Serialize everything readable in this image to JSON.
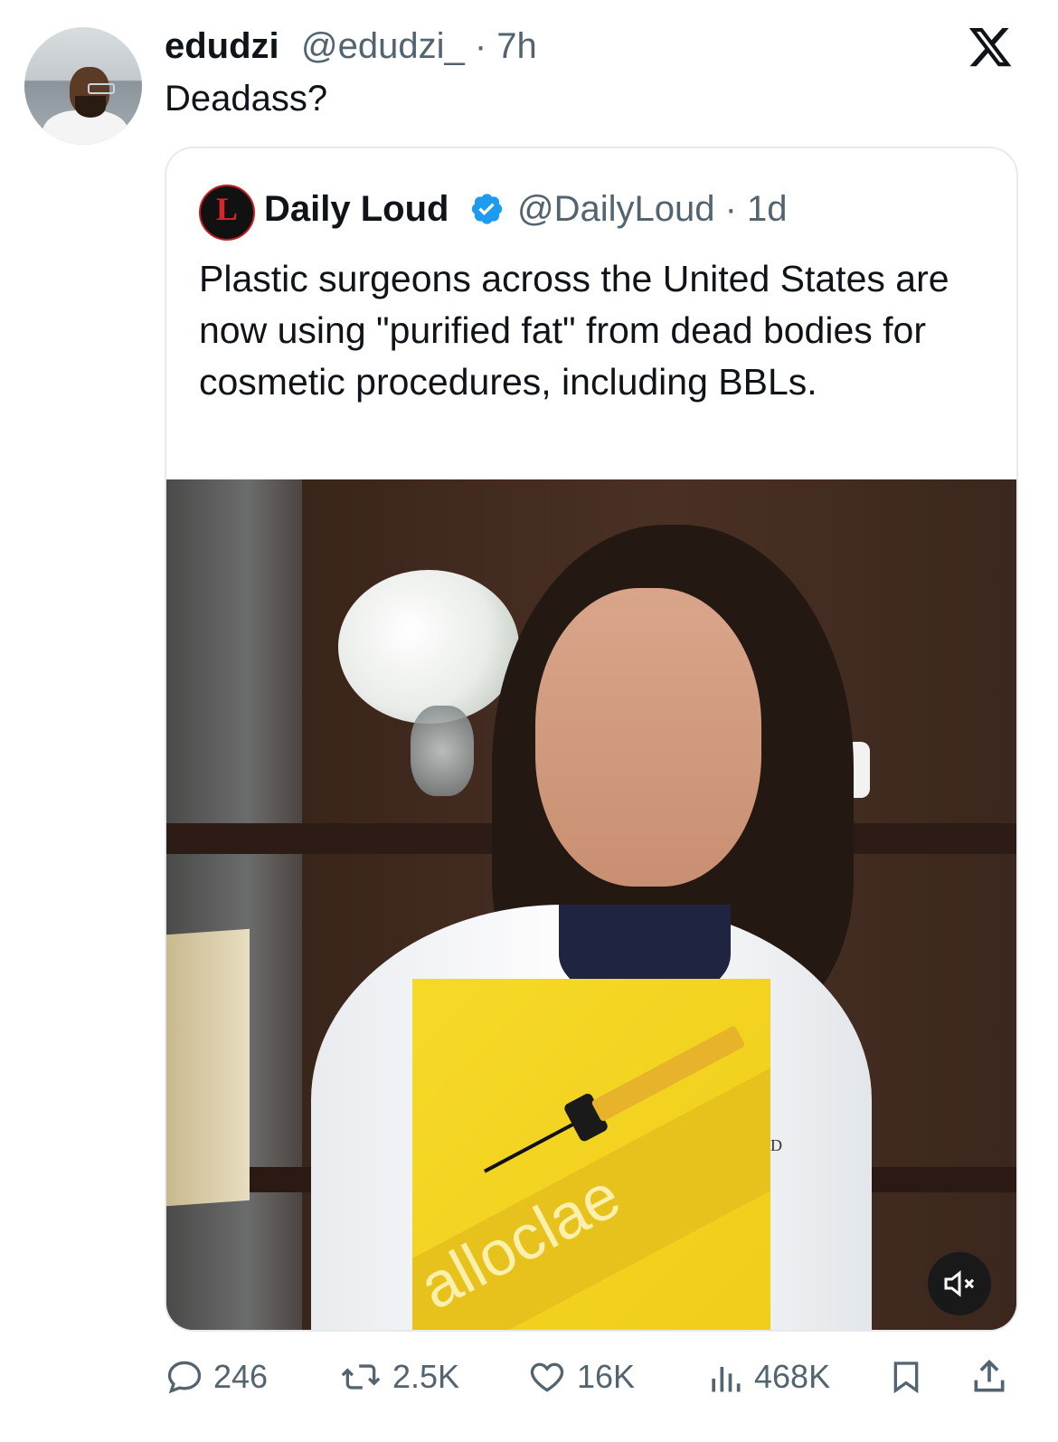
{
  "tweet": {
    "author_name": "edudzi",
    "author_handle_time": "@edudzi_ · 7h",
    "text": "Deadass?"
  },
  "quoted_tweet": {
    "author_name": "Daily Loud",
    "author_handle_time": "@DailyLoud · 1d",
    "text": "Plastic surgeons across the United States are now using \"purified fat\" from dead bodies for cosmetic procedures, including BBLs.",
    "media": {
      "product_word": "alloclae",
      "corner_text": "D"
    }
  },
  "actions": {
    "replies": "246",
    "reposts": "2.5K",
    "likes": "16K",
    "views": "468K"
  },
  "icons": {
    "brand": "x-logo-icon",
    "verified_color": "#1d9bf0"
  }
}
